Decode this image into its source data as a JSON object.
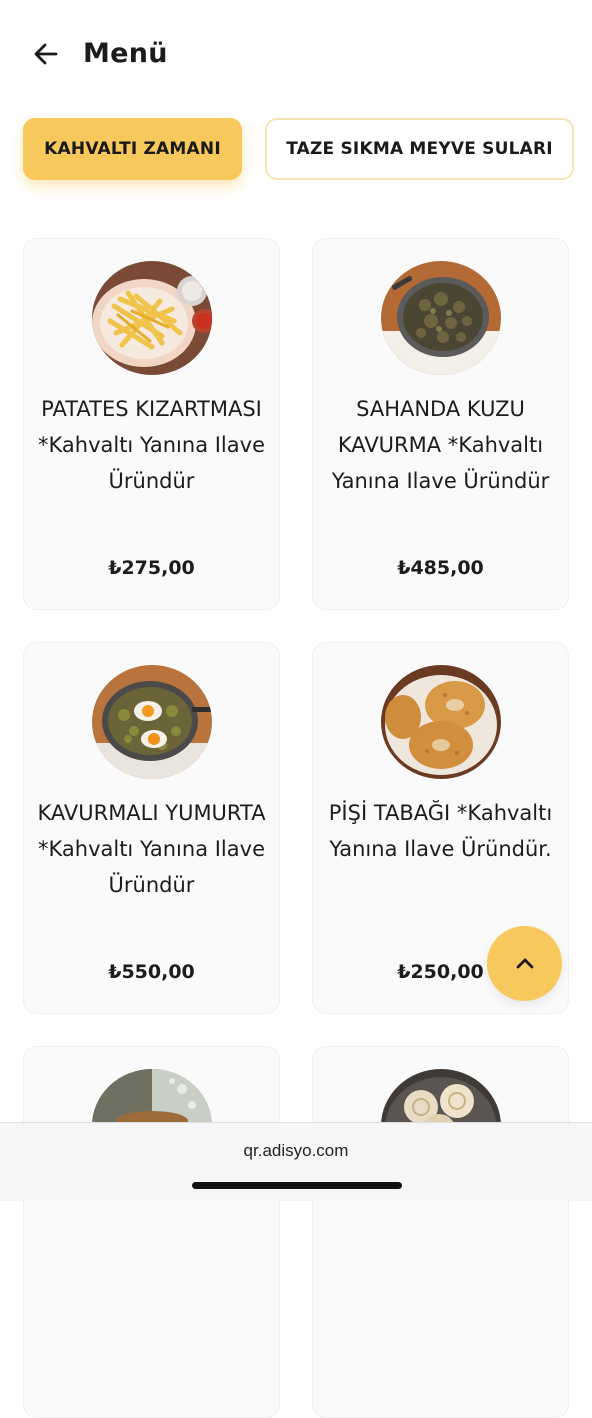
{
  "header": {
    "title": "Menü",
    "back_icon": "arrow-left-icon"
  },
  "tabs": [
    {
      "label": "KAHVALTI ZAMANI",
      "active": true
    },
    {
      "label": "TAZE SIKMA MEYVE SULARI",
      "active": false
    }
  ],
  "products": [
    {
      "name": "PATATES KIZARTMASI *Kahvaltı Yanına Ilave Üründür",
      "price": "₺275,00",
      "image": "french-fries-photo"
    },
    {
      "name": "SAHANDA KUZU KAVURMA *Kahvaltı Yanına Ilave Üründür",
      "price": "₺485,00",
      "image": "lamb-kavurma-pan-photo"
    },
    {
      "name": "KAVURMALI YUMURTA *Kahvaltı Yanına Ilave Üründür",
      "price": "₺550,00",
      "image": "eggs-with-kavurma-pan-photo"
    },
    {
      "name": "PİŞİ TABAĞI *Kahvaltı Yanına Ilave Üründür.",
      "price": "₺250,00",
      "image": "pisi-fried-dough-photo"
    },
    {
      "name": "",
      "price": "",
      "image": "partially-visible-dish-photo"
    },
    {
      "name": "",
      "price": "",
      "image": "partially-visible-cookies-photo"
    }
  ],
  "scroll_top": {
    "icon": "chevron-up-icon"
  },
  "footer": {
    "url": "qr.adisyo.com"
  },
  "colors": {
    "accent": "#f7c95d",
    "accent_border": "#f6e3b3",
    "card_bg": "#fafafa",
    "text": "#1c1c1c"
  }
}
